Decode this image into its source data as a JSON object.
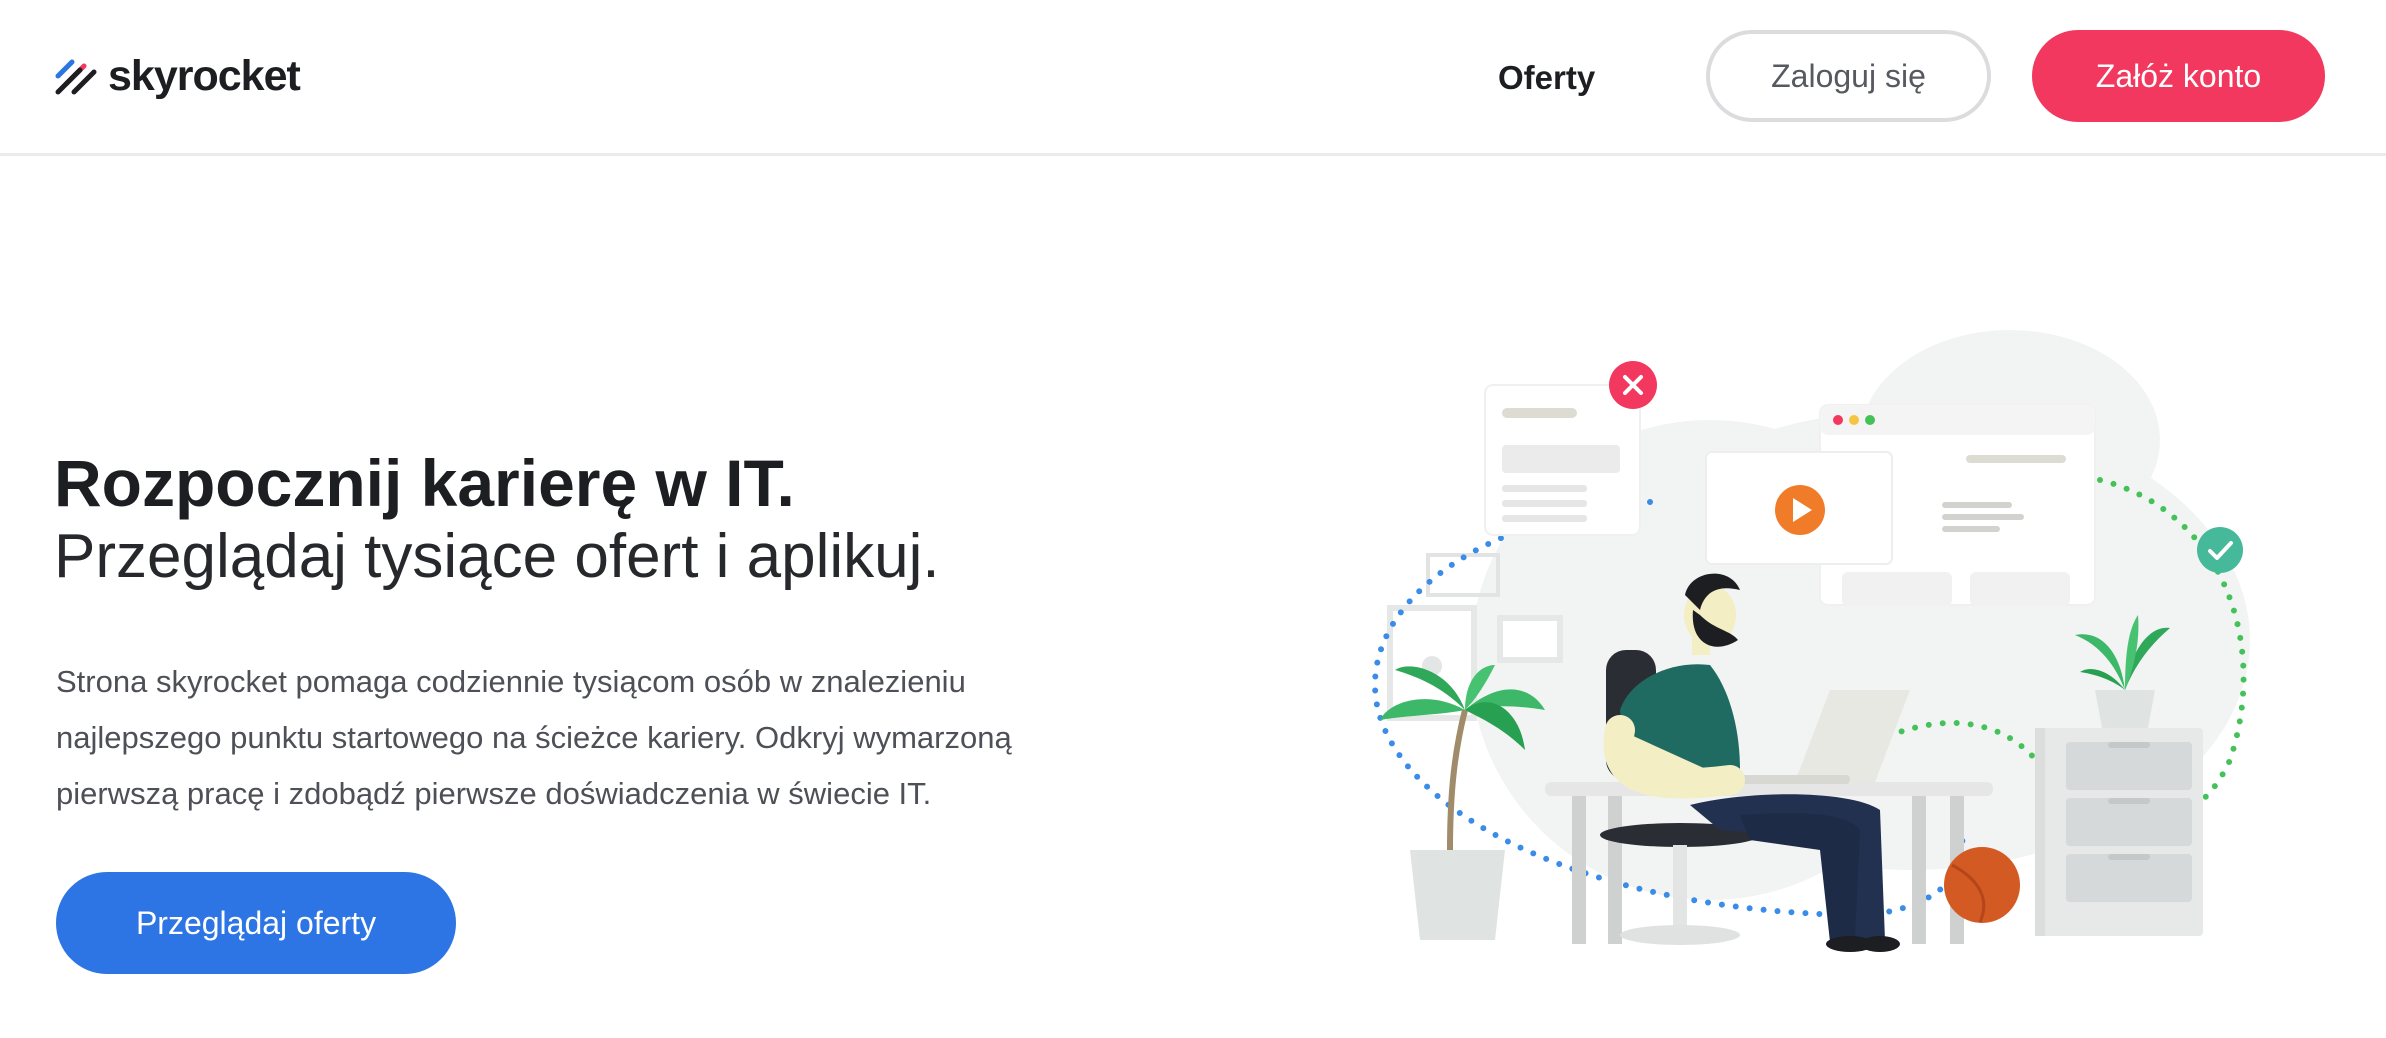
{
  "header": {
    "logo_text": "skyrocket",
    "nav": {
      "offers_label": "Oferty"
    },
    "login_label": "Zaloguj się",
    "signup_label": "Załóż konto"
  },
  "hero": {
    "title": "Rozpocznij karierę w IT.",
    "subtitle": "Przeglądaj tysiące ofert i aplikuj.",
    "description": "Strona skyrocket pomaga codziennie tysiącom osób w znalezieniu najlepszego punktu startowego na ścieżce kariery. Odkryj wymarzoną pierwszą pracę i zdobądź pierwsze doświadczenia w świecie IT.",
    "cta_label": "Przeglądaj oferty"
  },
  "colors": {
    "brand_red": "#f2385e",
    "brand_blue": "#2d74e5",
    "accent_green": "#3fc256"
  },
  "icons": {
    "logo": "skyrocket-stripes-icon",
    "reject": "close-icon",
    "accept": "check-icon",
    "video": "play-icon"
  }
}
